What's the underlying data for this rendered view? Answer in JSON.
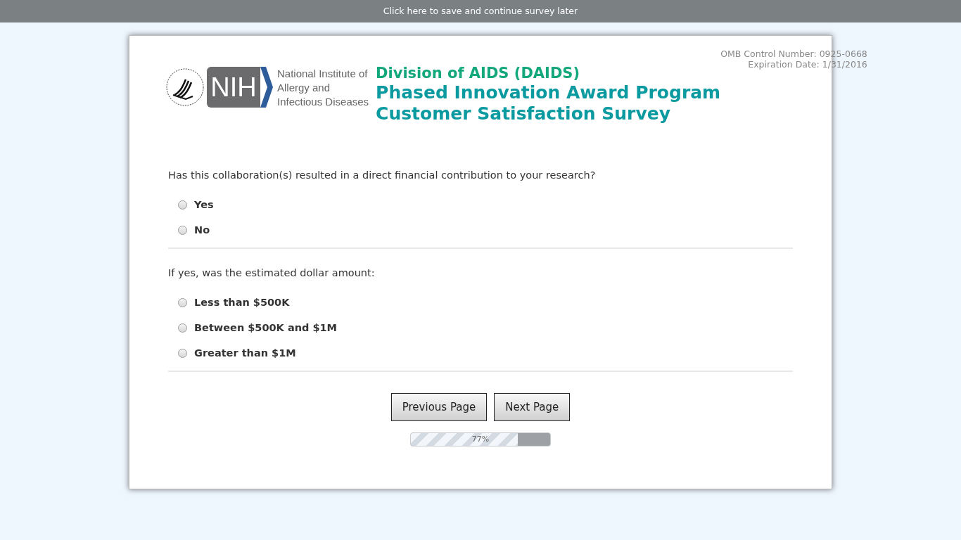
{
  "top_bar": {
    "link": "Click here to save and continue survey later"
  },
  "logo": {
    "mark": "NIH",
    "lines": [
      "National Institute of",
      "Allergy and",
      "Infectious Diseases"
    ]
  },
  "omb": {
    "control_number": "OMB Control Number: 0925-0668",
    "expiration": "Expiration Date: 1/31/2016"
  },
  "titles": {
    "division": "Division of AIDS (DAIDS)",
    "program": "Phased Innovation Award Program",
    "survey": "Customer Satisfaction Survey"
  },
  "questions": [
    {
      "text": "Has this collaboration(s) resulted in a direct financial contribution to your research?",
      "options": [
        {
          "label": "Yes",
          "selected": false
        },
        {
          "label": "No",
          "selected": false
        }
      ]
    },
    {
      "text": "If yes, was the estimated dollar amount:",
      "options": [
        {
          "label": "Less than $500K",
          "selected": false
        },
        {
          "label": "Between $500K and $1M",
          "selected": false
        },
        {
          "label": "Greater than $1M",
          "selected": false
        }
      ]
    }
  ],
  "buttons": [
    "Previous Page",
    "Next Page"
  ],
  "progress": {
    "level": 0.77,
    "reading": "77%"
  }
}
